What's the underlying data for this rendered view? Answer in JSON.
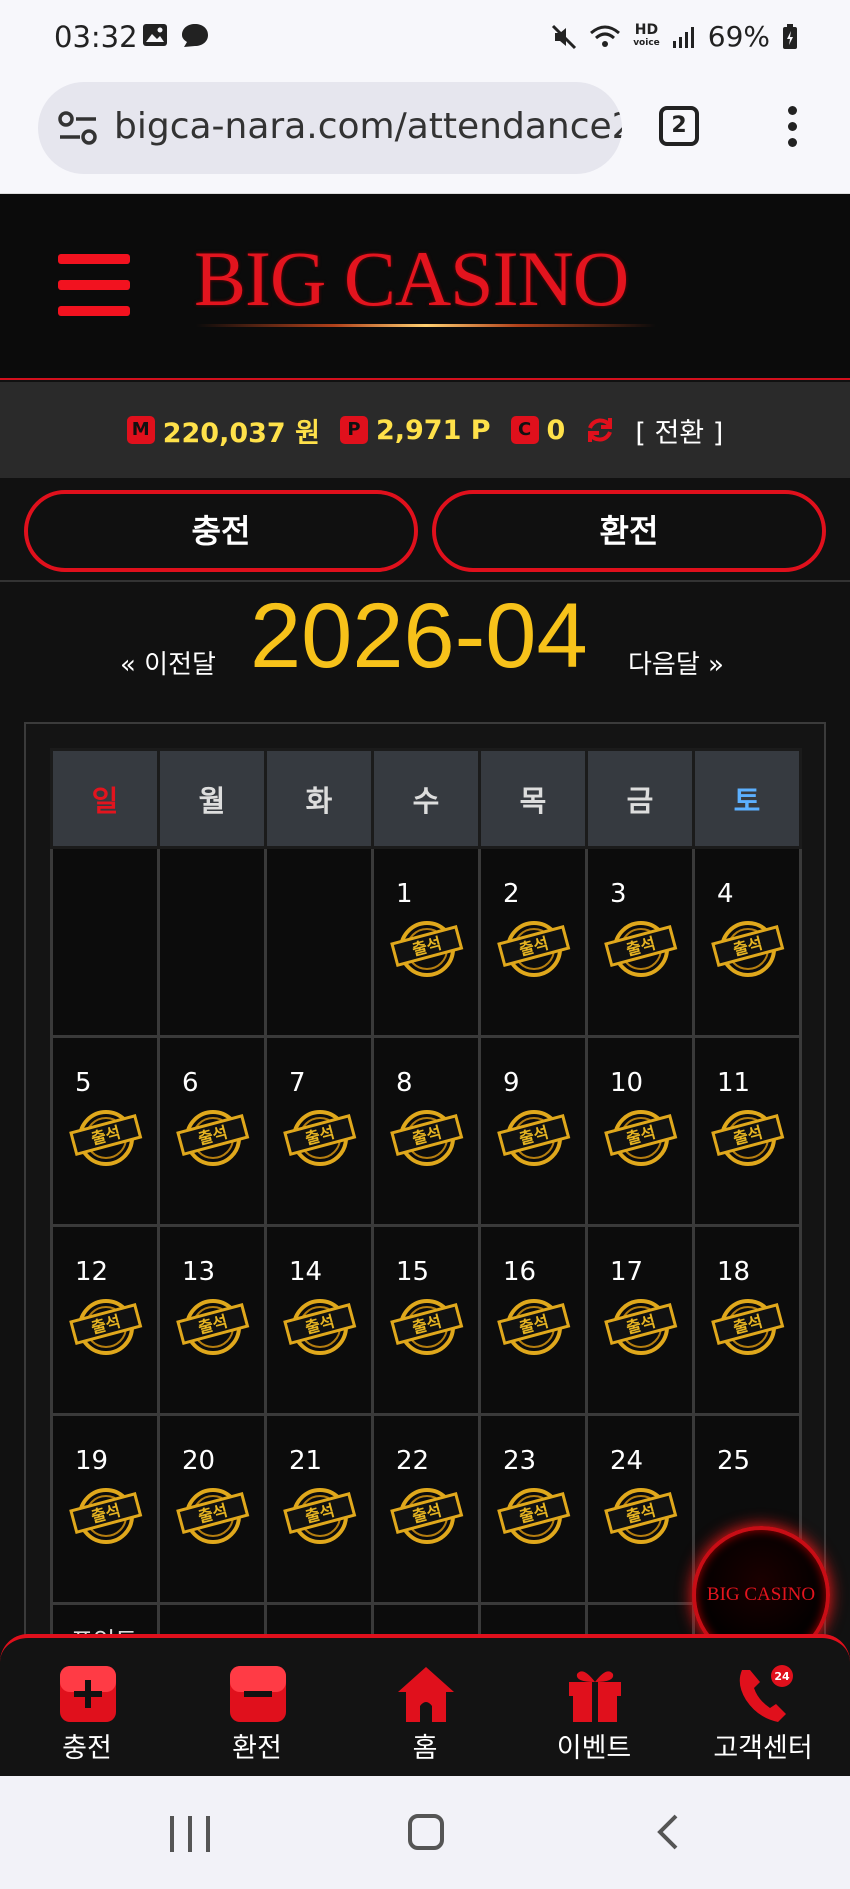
{
  "status_bar": {
    "time": "03:32",
    "battery": "69%",
    "hd_line1": "HD",
    "hd_line2": "voice"
  },
  "browser": {
    "url": "bigca-nara.com/attendance2",
    "tab_count": "2"
  },
  "site": {
    "logo_text": "BIG CASINO"
  },
  "balances": {
    "money_badge": "M",
    "money": "220,037 원",
    "point_badge": "P",
    "point": "2,971 P",
    "comp_badge": "C",
    "comp": "0",
    "convert_label": "[ 전환 ]"
  },
  "actions": {
    "deposit": "충전",
    "withdraw": "환전"
  },
  "calendar": {
    "prev_label": "« 이전달",
    "next_label": "다음달 »",
    "month": "2026-04",
    "weekdays": [
      "일",
      "월",
      "화",
      "수",
      "목",
      "금",
      "토"
    ],
    "weeks": [
      [
        null,
        null,
        null,
        1,
        2,
        3,
        4
      ],
      [
        5,
        6,
        7,
        8,
        9,
        10,
        11
      ],
      [
        12,
        13,
        14,
        15,
        16,
        17,
        18
      ],
      [
        19,
        20,
        21,
        22,
        23,
        24,
        25
      ]
    ],
    "attended_days": [
      1,
      2,
      3,
      4,
      5,
      6,
      7,
      8,
      9,
      10,
      11,
      12,
      13,
      14,
      15,
      16,
      17,
      18,
      19,
      20,
      21,
      22,
      23,
      24
    ],
    "stamp_label": "출석",
    "points_row_label": "포인트"
  },
  "floating_logo": "BIG CASINO",
  "bottom_nav": [
    {
      "label": "충전",
      "icon": "plus-box-icon"
    },
    {
      "label": "환전",
      "icon": "minus-box-icon"
    },
    {
      "label": "홈",
      "icon": "home-icon"
    },
    {
      "label": "이벤트",
      "icon": "gift-icon"
    },
    {
      "label": "고객센터",
      "icon": "phone-24-icon"
    }
  ],
  "colors": {
    "accent_red": "#e0101c",
    "gold": "#f7c21a",
    "balance_yellow": "#ffe14a",
    "saturday_blue": "#5cb0ff"
  }
}
